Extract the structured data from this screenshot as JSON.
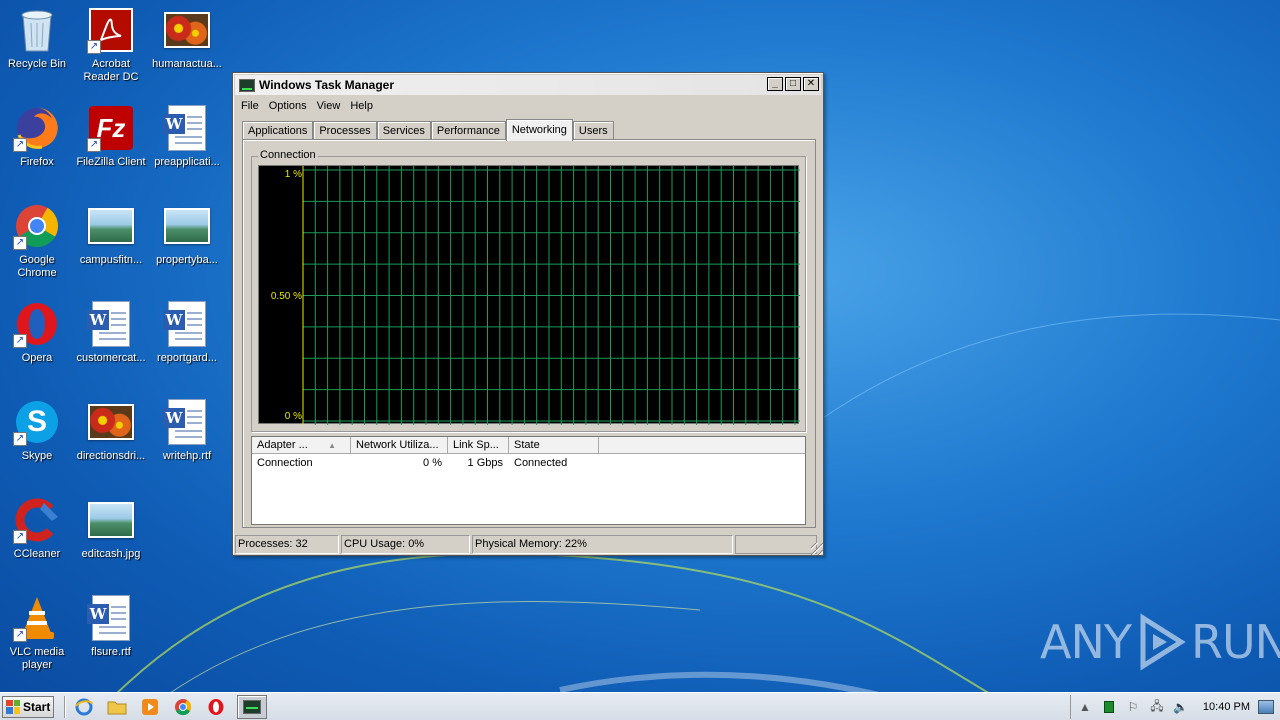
{
  "desktop": {
    "icons": [
      {
        "label": "Recycle Bin",
        "icon": "recycle-bin-icon"
      },
      {
        "label": "Acrobat Reader DC",
        "icon": "acrobat-icon"
      },
      {
        "label": "humanactua...",
        "icon": "image-file-icon"
      },
      {
        "label": "Firefox",
        "icon": "firefox-icon"
      },
      {
        "label": "FileZilla Client",
        "icon": "filezilla-icon"
      },
      {
        "label": "preapplicati...",
        "icon": "word-doc-icon"
      },
      {
        "label": "Google Chrome",
        "icon": "chrome-icon"
      },
      {
        "label": "campusfitn...",
        "icon": "image-file-icon"
      },
      {
        "label": "propertyba...",
        "icon": "image-file-icon"
      },
      {
        "label": "Opera",
        "icon": "opera-icon"
      },
      {
        "label": "customercat...",
        "icon": "word-doc-icon"
      },
      {
        "label": "reportgard...",
        "icon": "word-doc-icon"
      },
      {
        "label": "Skype",
        "icon": "skype-icon"
      },
      {
        "label": "directionsdri...",
        "icon": "image-file-icon"
      },
      {
        "label": "writehp.rtf",
        "icon": "word-doc-icon"
      },
      {
        "label": "CCleaner",
        "icon": "ccleaner-icon"
      },
      {
        "label": "editcash.jpg",
        "icon": "image-file-icon"
      },
      {
        "label": "VLC media player",
        "icon": "vlc-icon"
      },
      {
        "label": "flsure.rtf",
        "icon": "word-doc-icon"
      }
    ]
  },
  "window": {
    "title": "Windows Task Manager",
    "menu": [
      "File",
      "Options",
      "View",
      "Help"
    ],
    "tabs": [
      "Applications",
      "Processes",
      "Services",
      "Performance",
      "Networking",
      "Users"
    ],
    "active_tab": "Networking",
    "group_label": "Connection",
    "graph": {
      "y_labels": [
        "1 %",
        "0.50 %",
        "0 %"
      ],
      "grid_color": "#1e9a5a",
      "label_color": "#e8e800"
    },
    "list": {
      "columns": [
        "Adapter ...",
        "Network Utiliza...",
        "Link Sp...",
        "State"
      ],
      "rows": [
        {
          "adapter": "Connection",
          "utilization": "0 %",
          "link_speed": "1 Gbps",
          "state": "Connected"
        }
      ]
    },
    "status": {
      "processes": "Processes: 32",
      "cpu": "CPU Usage: 0%",
      "memory": "Physical Memory: 22%"
    }
  },
  "watermark": {
    "left": "ANY",
    "right": "RUN"
  },
  "taskbar": {
    "start_label": "Start",
    "clock": "10:40 PM"
  }
}
